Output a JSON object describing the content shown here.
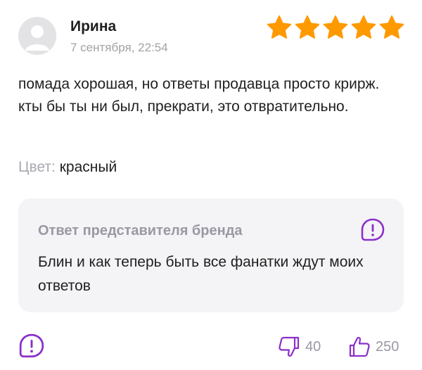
{
  "review": {
    "author": "Ирина",
    "date": "7 сентября, 22:54",
    "rating": 5,
    "text": "помада хорошая, но ответы продавца просто крирж. кты бы ты ни был, прекрати, это отвратительно.",
    "attribute_label": "Цвет:",
    "attribute_value": "красный"
  },
  "brand_reply": {
    "title": "Ответ представителя бренда",
    "text": "Блин и как теперь быть все фанатки ждут моих ответов"
  },
  "votes": {
    "dislikes": "40",
    "likes": "250"
  },
  "icons": {
    "star": "star-icon",
    "report": "report-icon",
    "dislike": "thumbs-down-icon",
    "like": "thumbs-up-icon"
  },
  "colors": {
    "star": "#FF9900",
    "accent": "#8B2FC9",
    "muted": "#9A98A4",
    "reply_bg": "#F4F4F6"
  }
}
